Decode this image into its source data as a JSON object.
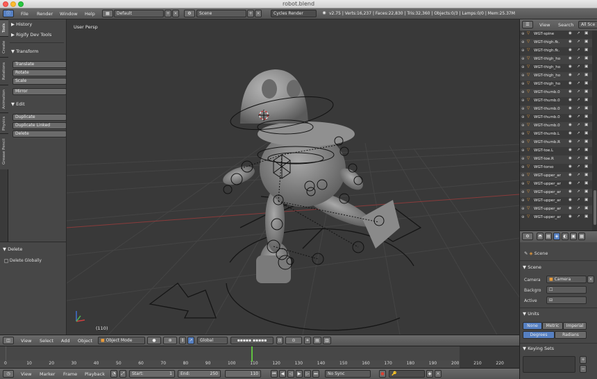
{
  "window": {
    "title": "robot.blend"
  },
  "infobar": {
    "menus": [
      "File",
      "Render",
      "Window",
      "Help"
    ],
    "layout": "Default",
    "scene": "Scene",
    "engine": "Cycles Render",
    "stats": "v2.75 | Verts:16,237 | Faces:22,830 | Tris:32,360 | Objects:0/3 | Lamps:0/0 | Mem:25.37M"
  },
  "tool_tabs": [
    "Tools",
    "Create",
    "Relations",
    "Animation",
    "Physics",
    "Grease Pencil"
  ],
  "toolshelf": {
    "history": "History",
    "rigify": "Rigify Dev Tools",
    "transform": "Transform",
    "transform_buttons": [
      "Translate",
      "Rotate",
      "Scale"
    ],
    "mirror": "Mirror",
    "edit": "Edit",
    "edit_buttons": [
      "Duplicate",
      "Duplicate Linked",
      "Delete"
    ]
  },
  "redo_panel": {
    "title": "Delete",
    "option": "Delete Globally"
  },
  "viewport": {
    "view_label": "User Persp",
    "frame_label": "(110)"
  },
  "viewport_header": {
    "menus": [
      "View",
      "Select",
      "Add",
      "Object"
    ],
    "mode": "Object Mode",
    "orientation": "Global"
  },
  "timeline": {
    "ticks": [
      "0",
      "10",
      "20",
      "30",
      "40",
      "50",
      "60",
      "70",
      "80",
      "90",
      "100",
      "110",
      "120",
      "130",
      "140",
      "150",
      "160",
      "170",
      "180",
      "190",
      "200",
      "210",
      "220"
    ],
    "current_frame": 110
  },
  "timeline_header": {
    "menus": [
      "View",
      "Marker",
      "Frame",
      "Playback"
    ],
    "start": "Start:",
    "start_value": "1",
    "end": "End:",
    "end_value": "250",
    "current": "110",
    "sync": "No Sync"
  },
  "outliner": {
    "header_buttons": [
      "View",
      "Search",
      "All Sce"
    ],
    "items": [
      "WGT-spine",
      "WGT-thigh.fk.",
      "WGT-thigh.fk.",
      "WGT-thigh_ho",
      "WGT-thigh_ho",
      "WGT-thigh_ho",
      "WGT-thigh_ho",
      "WGT-thumb.0",
      "WGT-thumb.0",
      "WGT-thumb.0",
      "WGT-thumb.0",
      "WGT-thumb.0",
      "WGT-thumb.L",
      "WGT-thumb.R",
      "WGT-toe.L",
      "WGT-toe.R",
      "WGT-torso",
      "WGT-upper_ar",
      "WGT-upper_ar",
      "WGT-upper_ar",
      "WGT-upper_ar",
      "WGT-upper_ar",
      "WGT-upper_ar"
    ]
  },
  "properties": {
    "context": "Scene",
    "scene_panel": "Scene",
    "camera_label": "Camera",
    "camera_value": "Camera",
    "backgr_label": "Backgro",
    "active_label": "Active",
    "units_panel": "Units",
    "unit_systems": [
      "None",
      "Metric",
      "Imperial"
    ],
    "rotation_units": [
      "Degrees",
      "Radians"
    ],
    "keying_panel": "Keying Sets"
  },
  "colors": {
    "accent": "#5680c2",
    "current_frame": "#60c040",
    "highlight": "#e89b3a"
  }
}
